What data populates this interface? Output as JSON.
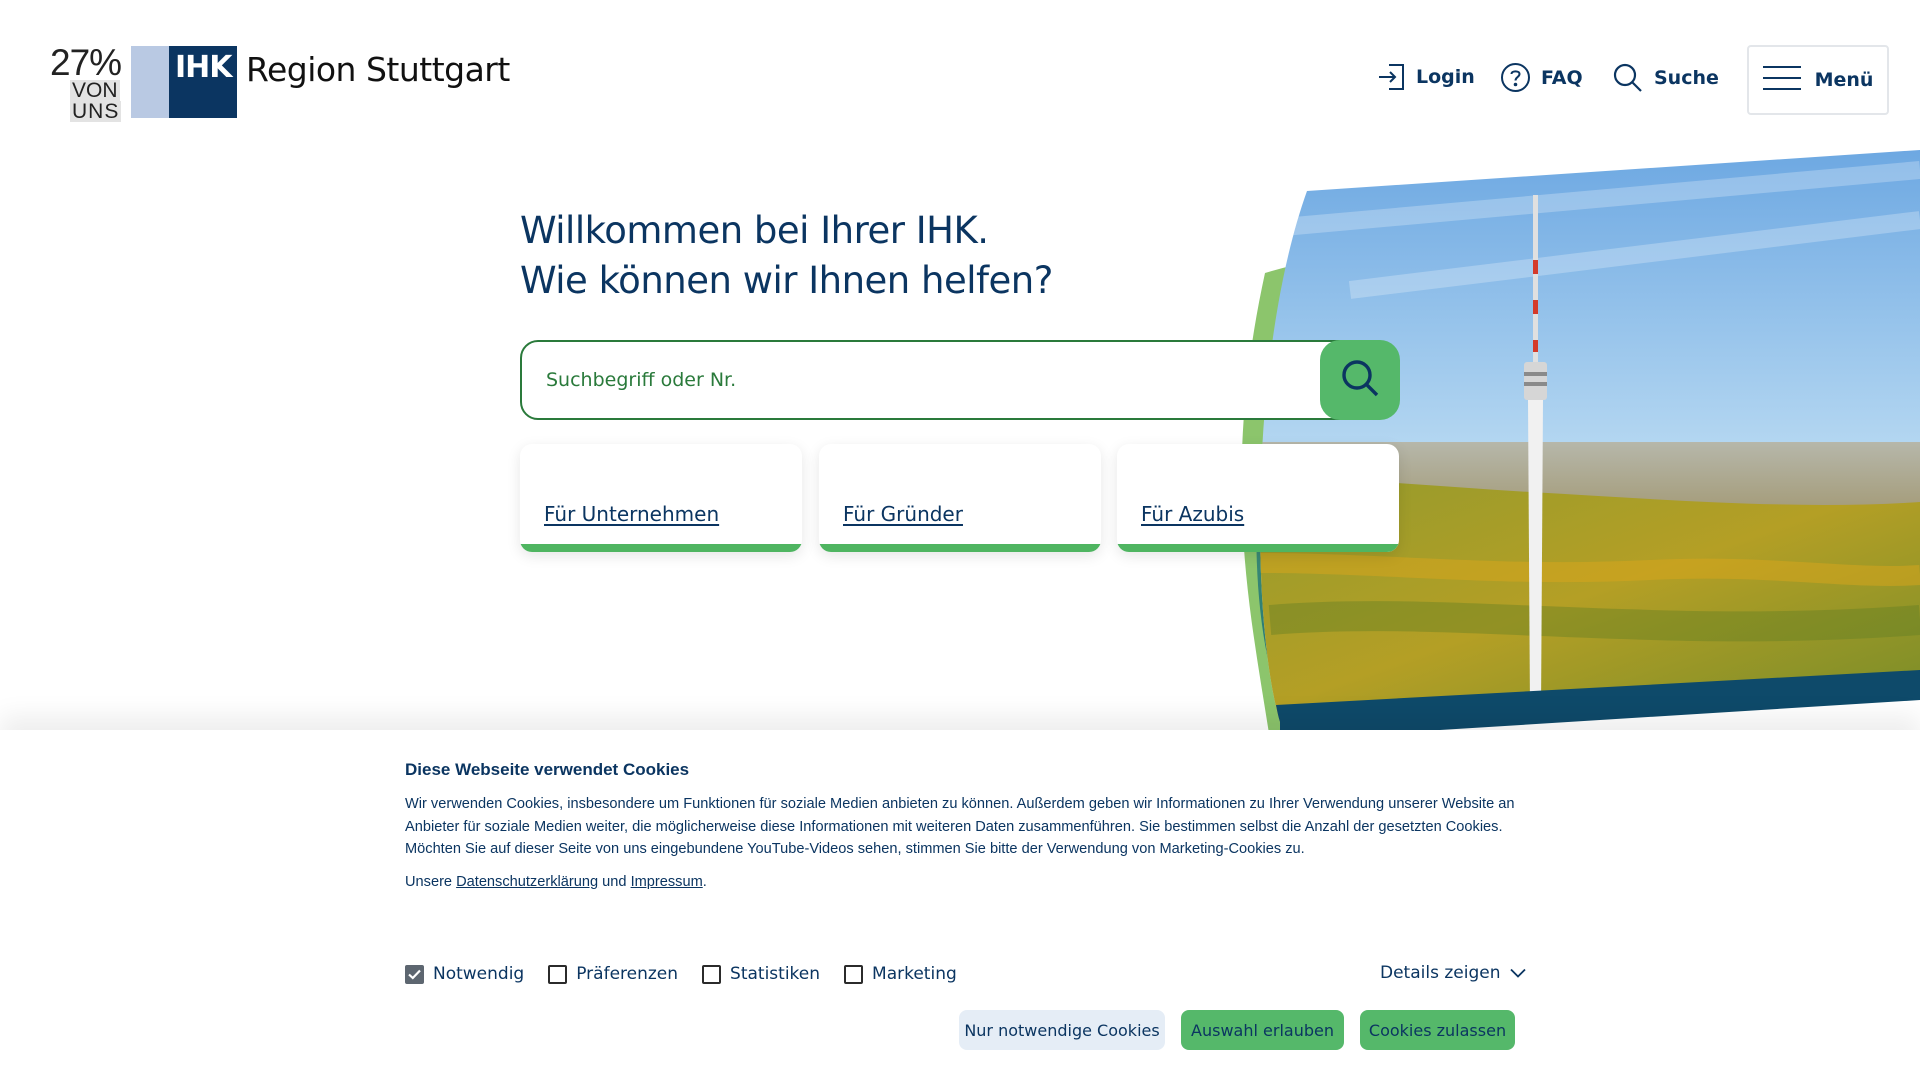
{
  "header": {
    "logo_badge": {
      "percent": "27%",
      "line1": "VON",
      "line2": "UNS"
    },
    "ihk_mark": "IHK",
    "region_name": "Region Stuttgart",
    "nav": {
      "login": "Login",
      "faq": "FAQ",
      "search": "Suche",
      "menu": "Menü"
    }
  },
  "hero": {
    "headline_line1": "Willkommen bei Ihrer IHK.",
    "headline_line2": "Wie können wir Ihnen helfen?",
    "search_placeholder": "Suchbegriff oder Nr.",
    "tiles": [
      {
        "label": "Für Unternehmen"
      },
      {
        "label": "Für Gründer"
      },
      {
        "label": "Für Azubis"
      }
    ]
  },
  "cookie_banner": {
    "title": "Diese Webseite verwendet Cookies",
    "text": "Wir verwenden Cookies, insbesondere um Funktionen für soziale Medien anbieten zu können. Außerdem geben wir Informationen zu Ihrer Verwendung unserer Website an Anbieter für soziale Medien weiter, die möglicherweise diese Informationen mit weiteren Daten zusammenführen. Sie bestimmen selbst die Anzahl der gesetzten Cookies. Möchten Sie auf dieser Seite von uns eingebundene YouTube-Videos sehen, stimmen Sie bitte der Verwendung von Marketing-Cookies zu.",
    "links_prefix": "Unsere",
    "privacy_link": "Datenschutzerklärung",
    "links_and": "und",
    "imprint_link": "Impressum",
    "links_suffix": ".",
    "checkboxes": [
      {
        "label": "Notwendig",
        "checked": true
      },
      {
        "label": "Präferenzen",
        "checked": false
      },
      {
        "label": "Statistiken",
        "checked": false
      },
      {
        "label": "Marketing",
        "checked": false
      }
    ],
    "details_toggle": "Details zeigen",
    "buttons": {
      "necessary_only": "Nur notwendige Cookies",
      "allow_selection": "Auswahl erlauben",
      "allow_all": "Cookies zulassen"
    }
  },
  "colors": {
    "brand_navy": "#0b3561",
    "brand_green": "#55b86a",
    "accent_green_dark": "#2a7a3b",
    "logo_light_blue": "#b9c9e3"
  },
  "icons": {
    "login": "login-icon",
    "faq": "question-circle-icon",
    "search": "search-icon",
    "menu": "hamburger-icon",
    "details": "chevron-down-icon"
  }
}
